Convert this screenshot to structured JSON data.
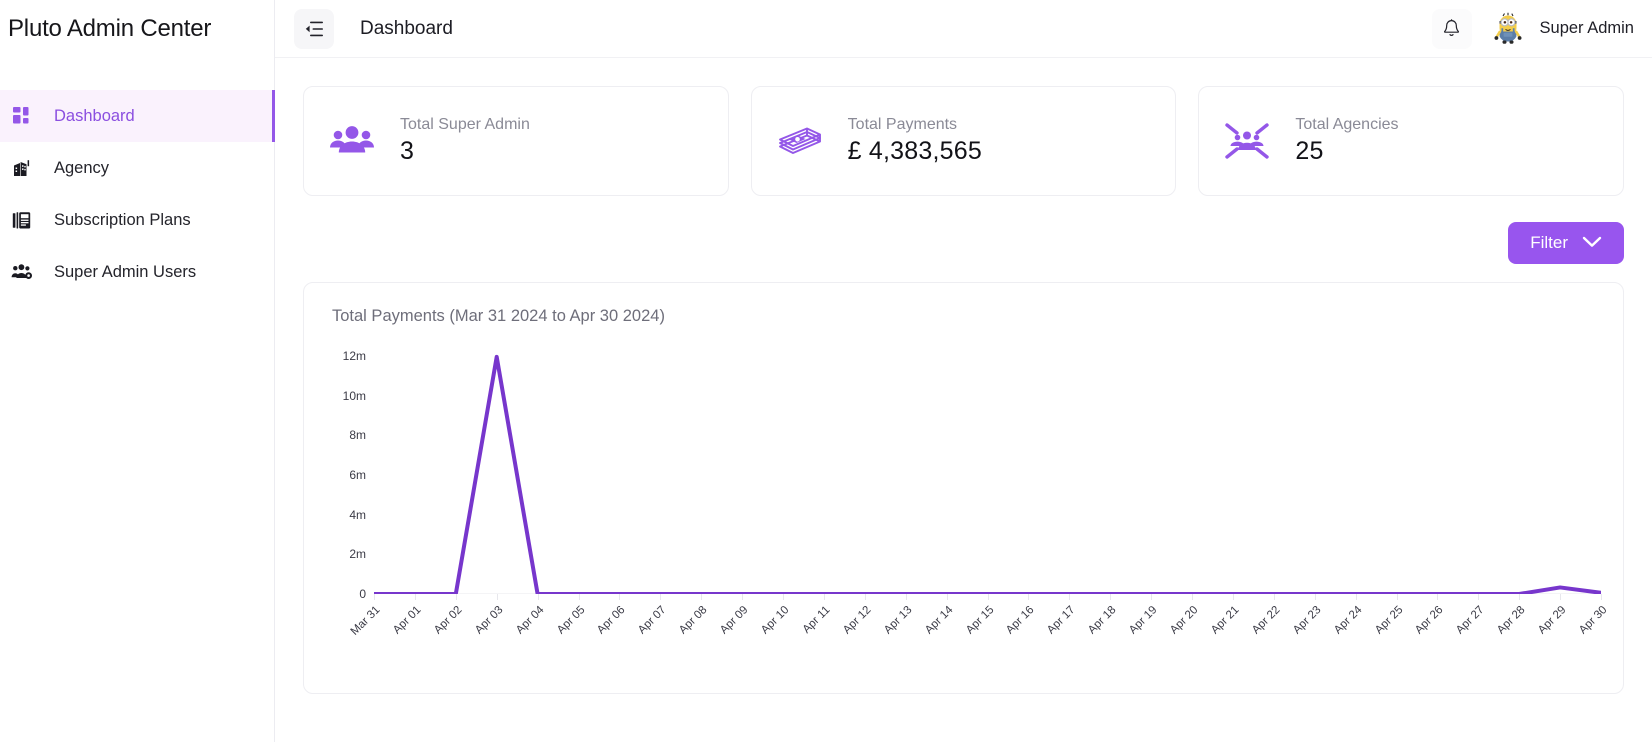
{
  "brand": {
    "title": "Pluto Admin Center"
  },
  "sidebar": {
    "items": [
      {
        "label": "Dashboard",
        "icon": "dashboard-grid-icon",
        "active": true
      },
      {
        "label": "Agency",
        "icon": "building-icon",
        "active": false
      },
      {
        "label": "Subscription Plans",
        "icon": "news-article-icon",
        "active": false
      },
      {
        "label": "Super Admin Users",
        "icon": "users-group-icon",
        "active": false
      }
    ]
  },
  "topbar": {
    "menu_icon": "collapse-sidebar-icon",
    "title": "Dashboard",
    "bell_icon": "bell-icon",
    "avatar_icon": "minion-avatar",
    "user_name": "Super Admin"
  },
  "stats": [
    {
      "icon": "people-group-icon",
      "label": "Total Super Admin",
      "value": "3"
    },
    {
      "icon": "money-stack-icon",
      "label": "Total Payments",
      "value": "£ 4,383,565"
    },
    {
      "icon": "agencies-icon",
      "label": "Total Agencies",
      "value": "25"
    }
  ],
  "filter": {
    "label": "Filter",
    "icon": "chevron-down-icon"
  },
  "colors": {
    "accent": "#9855ee",
    "line": "#7736cc",
    "active_bg": "#faf2fd",
    "active_text": "#8b4fe0",
    "card_border": "#eeeef2"
  },
  "chart_data": {
    "type": "line",
    "title": "Total Payments (Mar 31 2024 to Apr 30 2024)",
    "xlabel": "",
    "ylabel": "",
    "ylim": [
      0,
      12600000
    ],
    "yticks": [
      0,
      2000000,
      4000000,
      6000000,
      8000000,
      10000000,
      12000000
    ],
    "ytick_labels": [
      "0",
      "2m",
      "4m",
      "6m",
      "8m",
      "10m",
      "12m"
    ],
    "grid": false,
    "legend": "none",
    "categories": [
      "31 Mar",
      "01 Apr",
      "02 Apr",
      "03 Apr",
      "04 Apr",
      "05 Apr",
      "06 Apr",
      "07 Apr",
      "08 Apr",
      "09 Apr",
      "10 Apr",
      "11 Apr",
      "12 Apr",
      "13 Apr",
      "14 Apr",
      "15 Apr",
      "16 Apr",
      "17 Apr",
      "18 Apr",
      "19 Apr",
      "20 Apr",
      "21 Apr",
      "22 Apr",
      "23 Apr",
      "24 Apr",
      "25 Apr",
      "26 Apr",
      "27 Apr",
      "28 Apr",
      "29 Apr",
      "30 Apr"
    ],
    "series": [
      {
        "name": "Total Payments",
        "color": "#7736cc",
        "values": [
          0,
          0,
          0,
          11950000,
          0,
          0,
          0,
          0,
          0,
          0,
          0,
          0,
          0,
          0,
          0,
          0,
          0,
          0,
          0,
          0,
          0,
          0,
          0,
          0,
          0,
          0,
          0,
          0,
          0,
          330000,
          60000
        ]
      }
    ]
  }
}
